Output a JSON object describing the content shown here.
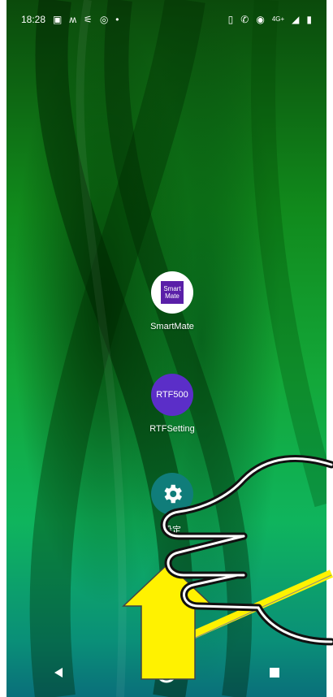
{
  "status_bar": {
    "time": "18:28",
    "left_icons": [
      "image-icon",
      "m-icon",
      "wifi-off-icon",
      "sync-icon",
      "dot-icon"
    ],
    "right_icons": [
      "vibrate-icon",
      "volte-icon",
      "hotspot-icon",
      "4g-icon",
      "signal-icon",
      "battery-icon"
    ],
    "network_label": "4G+"
  },
  "apps": [
    {
      "name": "SmartMate",
      "icon_text_line1": "Smart",
      "icon_text_line2": "Mate"
    },
    {
      "name": "RTFSetting",
      "icon_text": "RTF500"
    },
    {
      "name": "設定"
    }
  ],
  "colors": {
    "annotation_arrow": "#fff200",
    "smartmate_bg": "#5a1fa8",
    "rtf_bg": "#5b2ec8",
    "settings_bg": "#107d7a"
  },
  "nav_bar": [
    "back-icon",
    "home-icon",
    "recents-icon"
  ]
}
